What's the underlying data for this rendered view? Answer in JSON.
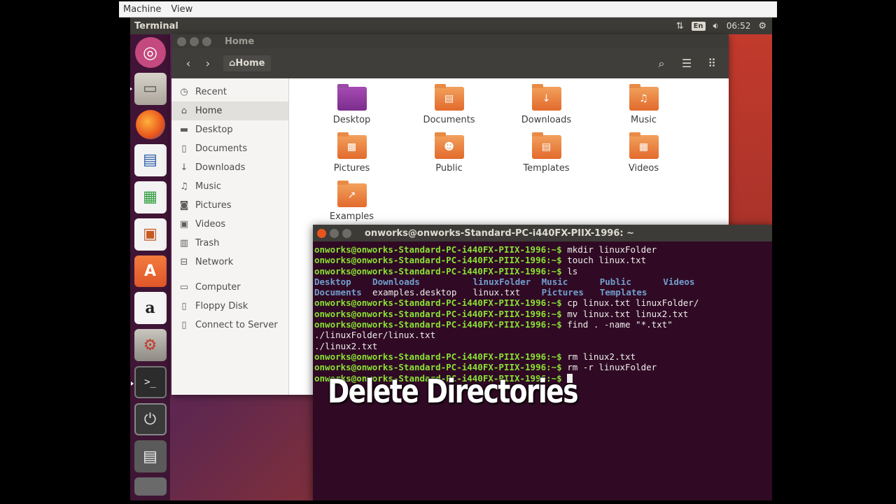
{
  "host_menu": {
    "items": [
      "Machine",
      "View"
    ]
  },
  "top_panel": {
    "title": "Terminal",
    "lang": "En",
    "time": "06:52"
  },
  "launcher": {
    "items": [
      {
        "name": "dash",
        "glyph": "◎"
      },
      {
        "name": "files",
        "glyph": "▭"
      },
      {
        "name": "firefox",
        "glyph": ""
      },
      {
        "name": "writer",
        "glyph": "▤"
      },
      {
        "name": "calc",
        "glyph": "▦"
      },
      {
        "name": "impress",
        "glyph": "▣"
      },
      {
        "name": "software",
        "glyph": "A"
      },
      {
        "name": "amazon",
        "glyph": "a"
      },
      {
        "name": "settings",
        "glyph": "⚙"
      },
      {
        "name": "terminal",
        "glyph": ">_"
      },
      {
        "name": "usb",
        "glyph": "⏻"
      },
      {
        "name": "floppy",
        "glyph": "▤"
      }
    ]
  },
  "files": {
    "title": "Home",
    "path_label": "Home",
    "sidebar": [
      {
        "label": "Recent",
        "icon": "◷"
      },
      {
        "label": "Home",
        "icon": "⌂"
      },
      {
        "label": "Desktop",
        "icon": "▬"
      },
      {
        "label": "Documents",
        "icon": "▯"
      },
      {
        "label": "Downloads",
        "icon": "↓"
      },
      {
        "label": "Music",
        "icon": "♫"
      },
      {
        "label": "Pictures",
        "icon": "◙"
      },
      {
        "label": "Videos",
        "icon": "▣"
      },
      {
        "label": "Trash",
        "icon": "▥"
      },
      {
        "label": "Network",
        "icon": "⊟"
      },
      {
        "label": "Computer",
        "icon": "▭"
      },
      {
        "label": "Floppy Disk",
        "icon": "▯"
      },
      {
        "label": "Connect to Server",
        "icon": "▯"
      }
    ],
    "folders": [
      {
        "label": "Desktop",
        "glyph": ""
      },
      {
        "label": "Documents",
        "glyph": "▤"
      },
      {
        "label": "Downloads",
        "glyph": "↓"
      },
      {
        "label": "Music",
        "glyph": "♫"
      },
      {
        "label": "Pictures",
        "glyph": "▩"
      },
      {
        "label": "Public",
        "glyph": "☻"
      },
      {
        "label": "Templates",
        "glyph": "▤"
      },
      {
        "label": "Videos",
        "glyph": "▦"
      },
      {
        "label": "Examples",
        "glyph": "↗"
      }
    ]
  },
  "terminal": {
    "title": "onworks@onworks-Standard-PC-i440FX-PIIX-1996: ~",
    "prompt": "onworks@onworks-Standard-PC-i440FX-PIIX-1996:~$",
    "lines": [
      {
        "type": "cmd",
        "text": "mkdir linuxFolder"
      },
      {
        "type": "cmd",
        "text": "touch linux.txt"
      },
      {
        "type": "cmd",
        "text": "ls"
      },
      {
        "type": "ls",
        "cols": [
          {
            "text": "Desktop",
            "dir": true,
            "col": 0
          },
          {
            "text": "Downloads",
            "dir": true,
            "col": 11
          },
          {
            "text": "linuxFolder",
            "dir": true,
            "col": 30
          },
          {
            "text": "Music",
            "dir": true,
            "col": 43
          },
          {
            "text": "Public",
            "dir": true,
            "col": 54
          },
          {
            "text": "Videos",
            "dir": true,
            "col": 66
          }
        ]
      },
      {
        "type": "ls",
        "cols": [
          {
            "text": "Documents",
            "dir": true,
            "col": 0
          },
          {
            "text": "examples.desktop",
            "dir": false,
            "col": 11
          },
          {
            "text": "linux.txt",
            "dir": false,
            "col": 30
          },
          {
            "text": "Pictures",
            "dir": true,
            "col": 43
          },
          {
            "text": "Templates",
            "dir": true,
            "col": 54
          }
        ]
      },
      {
        "type": "cmd",
        "text": "cp linux.txt linuxFolder/"
      },
      {
        "type": "cmd",
        "text": "mv linux.txt linux2.txt"
      },
      {
        "type": "cmd",
        "text": "find . -name \"*.txt\""
      },
      {
        "type": "out",
        "text": "./linuxFolder/linux.txt"
      },
      {
        "type": "out",
        "text": "./linux2.txt"
      },
      {
        "type": "cmd",
        "text": "rm linux2.txt"
      },
      {
        "type": "cmd",
        "text": "rm -r linuxFolder"
      },
      {
        "type": "cursor",
        "text": ""
      }
    ]
  },
  "caption": "Delete Directories",
  "colors": {
    "prompt": "#8ae234",
    "directory": "#729fcf",
    "terminal_bg": "#300a24",
    "folder_orange": "#e26a2c",
    "panel": "#3c3b37"
  }
}
